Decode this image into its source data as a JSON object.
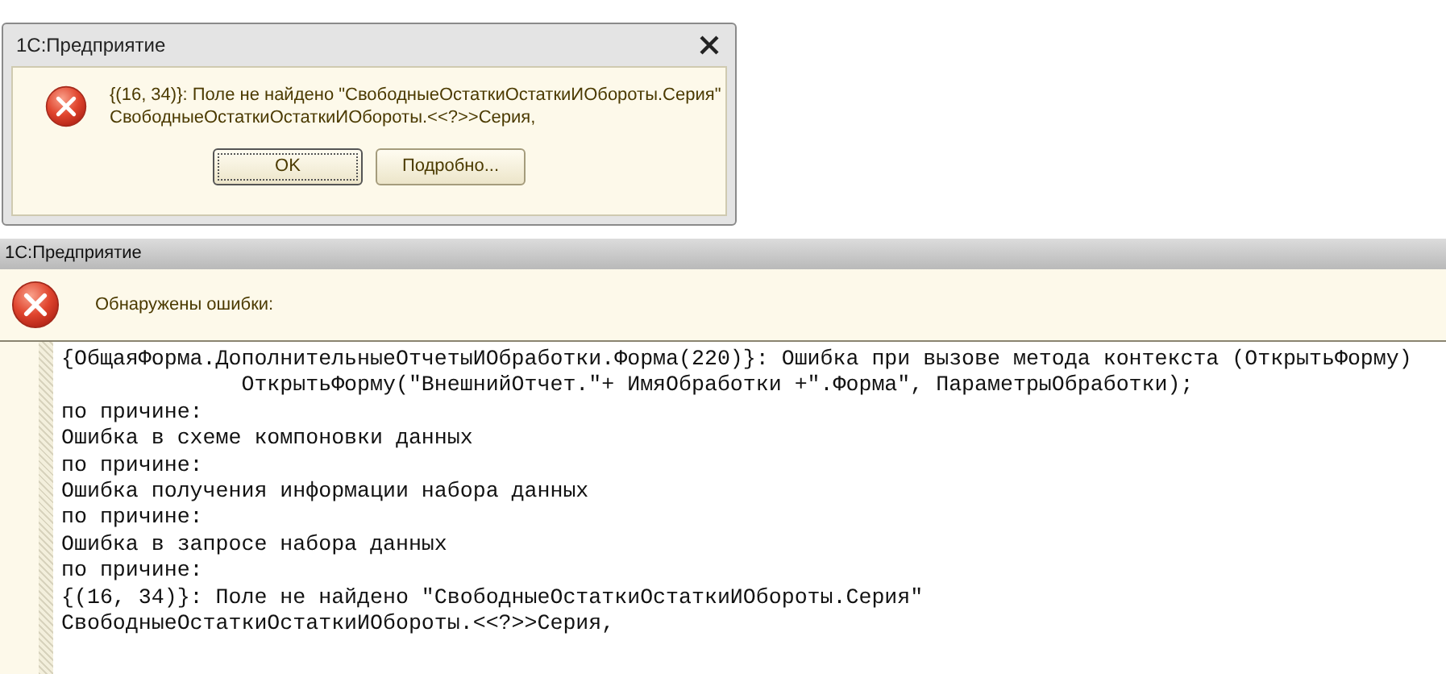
{
  "dialog": {
    "title": "1С:Предприятие",
    "message_lines": [
      "{(16, 34)}: Поле не найдено \"СвободныеОстаткиОстаткиИОбороты.Серия\"",
      "СвободныеОстаткиОстаткиИОбороты.<<?>>Серия,"
    ],
    "buttons": [
      {
        "label": "OK",
        "focused": true
      },
      {
        "label": "Подробно...",
        "focused": false
      }
    ]
  },
  "window": {
    "title": "1С:Предприятие",
    "header": "Обнаружены ошибки:",
    "lines": [
      "{ОбщаяФорма.ДополнительныеОтчетыИОбработки.Форма(220)}: Ошибка при вызове метода контекста (ОткрытьФорму)",
      "              ОткрытьФорму(\"ВнешнийОтчет.\"+ ИмяОбработки +\".Форма\", ПараметрыОбработки);",
      "по причине:",
      "Ошибка в схеме компоновки данных",
      "по причине:",
      "Ошибка получения информации набора данных",
      "по причине:",
      "Ошибка в запросе набора данных",
      "по причине:",
      "{(16, 34)}: Поле не найдено \"СвободныеОстаткиОстаткиИОбороты.Серия\"",
      "СвободныеОстаткиОстаткиИОбороты.<<?>>Серия,"
    ]
  }
}
